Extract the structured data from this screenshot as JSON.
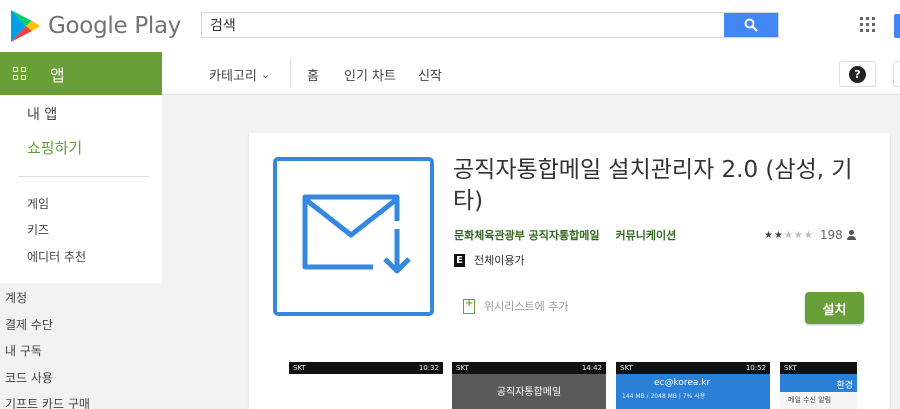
{
  "header": {
    "logo_text": "Google Play",
    "search_value": "검색"
  },
  "nav": {
    "app_tab": "앱",
    "categories": "카테고리",
    "home": "홈",
    "top_charts": "인기 차트",
    "new_releases": "신작",
    "help": "?"
  },
  "sidebar": {
    "my_apps": "내 앱",
    "shop": "쇼핑하기",
    "categories": [
      "게임",
      "키즈",
      "에디터 추천"
    ],
    "account": [
      "계정",
      "결제 수단",
      "내 구독",
      "코드 사용",
      "기프트 카드 구매"
    ]
  },
  "app": {
    "title": "공직자통합메일 설치관리자 2.0 (삼성, 기타)",
    "developer_1": "문화체육관광부 공직자통합메일",
    "developer_2": "커뮤니케이션",
    "rating_stars": "★★★★★",
    "rating_count": "198",
    "content_rating_badge": "E",
    "content_rating": "전체이용가",
    "wishlist": "위시리스트에 추가",
    "install": "설치"
  },
  "screenshots": [
    {
      "carrier": "SKT",
      "status": "10:32",
      "caption": ""
    },
    {
      "carrier": "SKT",
      "status": "14:42",
      "caption": "공직자통합메일"
    },
    {
      "carrier": "SKT",
      "status": "10:52",
      "caption": "ec@korea.kr",
      "sub": "144 MB / 2048 MB | 7% 사용"
    },
    {
      "carrier": "SKT",
      "status": "",
      "caption": "환경",
      "sub": "메일 수신 알림"
    }
  ],
  "colors": {
    "brand_green": "#689f38",
    "dark_green": "#33691e",
    "search_blue": "#4285f4",
    "icon_blue": "#3588e0"
  }
}
